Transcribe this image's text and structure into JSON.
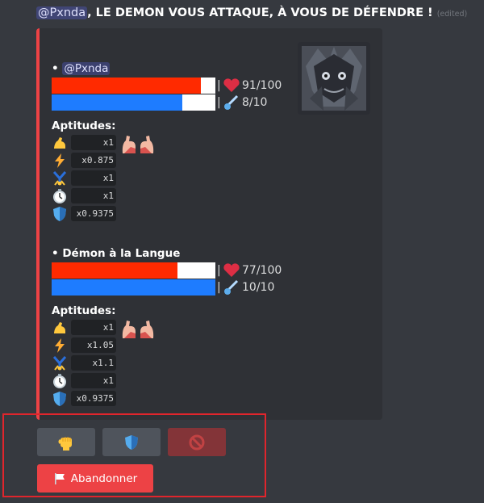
{
  "message": {
    "mention": "@Pxnda",
    "text": ", LE DEMON VOUS ATTAQUE, À VOUS DE DÉFENDRE !",
    "edited": "(edited)"
  },
  "embed": {
    "accent_color": "#ed4245",
    "thumbnail_icon": "demon-avatar",
    "fighters": [
      {
        "name_prefix": "• ",
        "name": "@Pxnda",
        "hp": {
          "value": 91,
          "max": 100,
          "text": "91/100"
        },
        "energy": {
          "value": 8,
          "max": 10,
          "text": "8/10"
        },
        "aptitudes_title": "Aptitudes:",
        "aptitudes": [
          {
            "icon": "flexed-biceps-icon",
            "value": "x1"
          },
          {
            "icon": "lightning-icon",
            "value": "x0.875"
          },
          {
            "icon": "cartwheel-icon",
            "value": "x1"
          },
          {
            "icon": "stopwatch-icon",
            "value": "x1"
          },
          {
            "icon": "shield-icon",
            "value": "x0.9375"
          }
        ]
      },
      {
        "name_prefix": "• ",
        "name": "Démon à la Langue",
        "hp": {
          "value": 77,
          "max": 100,
          "text": "77/100"
        },
        "energy": {
          "value": 10,
          "max": 10,
          "text": "10/10"
        },
        "aptitudes_title": "Aptitudes:",
        "aptitudes": [
          {
            "icon": "flexed-biceps-icon",
            "value": "x1"
          },
          {
            "icon": "lightning-icon",
            "value": "x1.05"
          },
          {
            "icon": "cartwheel-icon",
            "value": "x1.1"
          },
          {
            "icon": "stopwatch-icon",
            "value": "x1"
          },
          {
            "icon": "shield-icon",
            "value": "x0.9375"
          }
        ]
      }
    ],
    "hp_color": "#ff2a00",
    "energy_color": "#1e7cff"
  },
  "buttons": {
    "attack_icon": "raised-fist-icon",
    "defend_icon": "shield-icon",
    "disabled_icon": "prohibited-icon",
    "abandon_label": "Abandonner",
    "abandon_icon": "white-flag-icon"
  }
}
